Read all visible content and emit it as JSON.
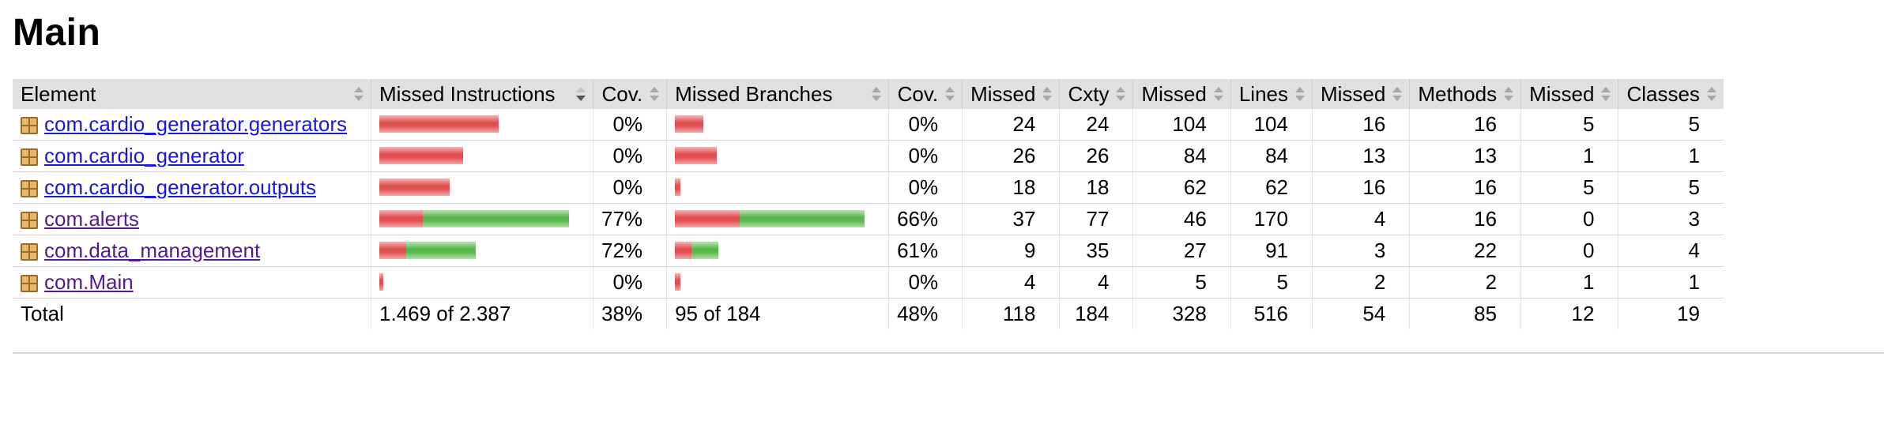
{
  "page": {
    "title": "Main"
  },
  "table": {
    "headers": {
      "element": "Element",
      "missed_instructions": "Missed Instructions",
      "cov1": "Cov.",
      "missed_branches": "Missed Branches",
      "cov2": "Cov.",
      "cxty_missed": "Missed",
      "cxty": "Cxty",
      "lines_missed": "Missed",
      "lines": "Lines",
      "methods_missed": "Missed",
      "methods": "Methods",
      "classes_missed": "Missed",
      "classes": "Classes"
    },
    "rows": [
      {
        "name": "com.cardio_generator.generators",
        "visited": false,
        "instr_missed_frac": 1.0,
        "instr_bar_scale": 0.63,
        "instr_cov": "0%",
        "branch_missed_frac": 1.0,
        "branch_bar_scale": 0.15,
        "branch_cov": "0%",
        "cxty_missed": "24",
        "cxty": "24",
        "lines_missed": "104",
        "lines": "104",
        "methods_missed": "16",
        "methods": "16",
        "classes_missed": "5",
        "classes": "5"
      },
      {
        "name": "com.cardio_generator",
        "visited": false,
        "instr_missed_frac": 1.0,
        "instr_bar_scale": 0.44,
        "instr_cov": "0%",
        "branch_missed_frac": 1.0,
        "branch_bar_scale": 0.22,
        "branch_cov": "0%",
        "cxty_missed": "26",
        "cxty": "26",
        "lines_missed": "84",
        "lines": "84",
        "methods_missed": "13",
        "methods": "13",
        "classes_missed": "1",
        "classes": "1"
      },
      {
        "name": "com.cardio_generator.outputs",
        "visited": false,
        "instr_missed_frac": 1.0,
        "instr_bar_scale": 0.37,
        "instr_cov": "0%",
        "branch_missed_frac": 1.0,
        "branch_bar_scale": 0.03,
        "branch_cov": "0%",
        "cxty_missed": "18",
        "cxty": "18",
        "lines_missed": "62",
        "lines": "62",
        "methods_missed": "16",
        "methods": "16",
        "classes_missed": "5",
        "classes": "5"
      },
      {
        "name": "com.alerts",
        "visited": true,
        "instr_missed_frac": 0.23,
        "instr_bar_scale": 1.0,
        "instr_cov": "77%",
        "branch_missed_frac": 0.34,
        "branch_bar_scale": 1.0,
        "branch_cov": "66%",
        "cxty_missed": "37",
        "cxty": "77",
        "lines_missed": "46",
        "lines": "170",
        "methods_missed": "4",
        "methods": "16",
        "classes_missed": "0",
        "classes": "3"
      },
      {
        "name": "com.data_management",
        "visited": true,
        "instr_missed_frac": 0.28,
        "instr_bar_scale": 0.51,
        "instr_cov": "72%",
        "branch_missed_frac": 0.39,
        "branch_bar_scale": 0.23,
        "branch_cov": "61%",
        "cxty_missed": "9",
        "cxty": "35",
        "lines_missed": "27",
        "lines": "91",
        "methods_missed": "3",
        "methods": "22",
        "classes_missed": "0",
        "classes": "4"
      },
      {
        "name": "com.Main",
        "visited": true,
        "instr_missed_frac": 1.0,
        "instr_bar_scale": 0.02,
        "instr_cov": "0%",
        "branch_missed_frac": 1.0,
        "branch_bar_scale": 0.03,
        "branch_cov": "0%",
        "cxty_missed": "4",
        "cxty": "4",
        "lines_missed": "5",
        "lines": "5",
        "methods_missed": "2",
        "methods": "2",
        "classes_missed": "1",
        "classes": "1"
      }
    ],
    "total": {
      "label": "Total",
      "instr": "1.469 of 2.387",
      "instr_cov": "38%",
      "branch": "95 of 184",
      "branch_cov": "48%",
      "cxty_missed": "118",
      "cxty": "184",
      "lines_missed": "328",
      "lines": "516",
      "methods_missed": "54",
      "methods": "85",
      "classes_missed": "12",
      "classes": "19"
    }
  },
  "colors": {
    "missed": "#e05050",
    "covered": "#5ab84c",
    "link": "#1a1ad6",
    "link_visited": "#551a8b",
    "header_bg": "#e0e0e0"
  }
}
